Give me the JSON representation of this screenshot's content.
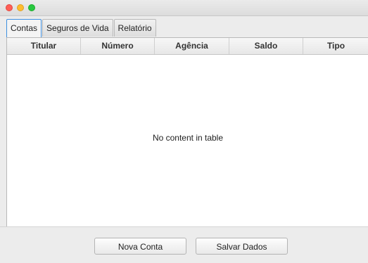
{
  "tabs": [
    {
      "label": "Contas",
      "active": true
    },
    {
      "label": "Seguros de Vida",
      "active": false
    },
    {
      "label": "Relatório",
      "active": false
    }
  ],
  "table": {
    "columns": [
      "Titular",
      "Número",
      "Agência",
      "Saldo",
      "Tipo"
    ],
    "placeholder": "No content in table"
  },
  "buttons": {
    "new_account": "Nova Conta",
    "save_data": "Salvar Dados"
  },
  "colors": {
    "close": "#ff5f57",
    "minimize": "#febc2e",
    "maximize": "#28c840",
    "active_tab_border": "#3d8fe0"
  }
}
